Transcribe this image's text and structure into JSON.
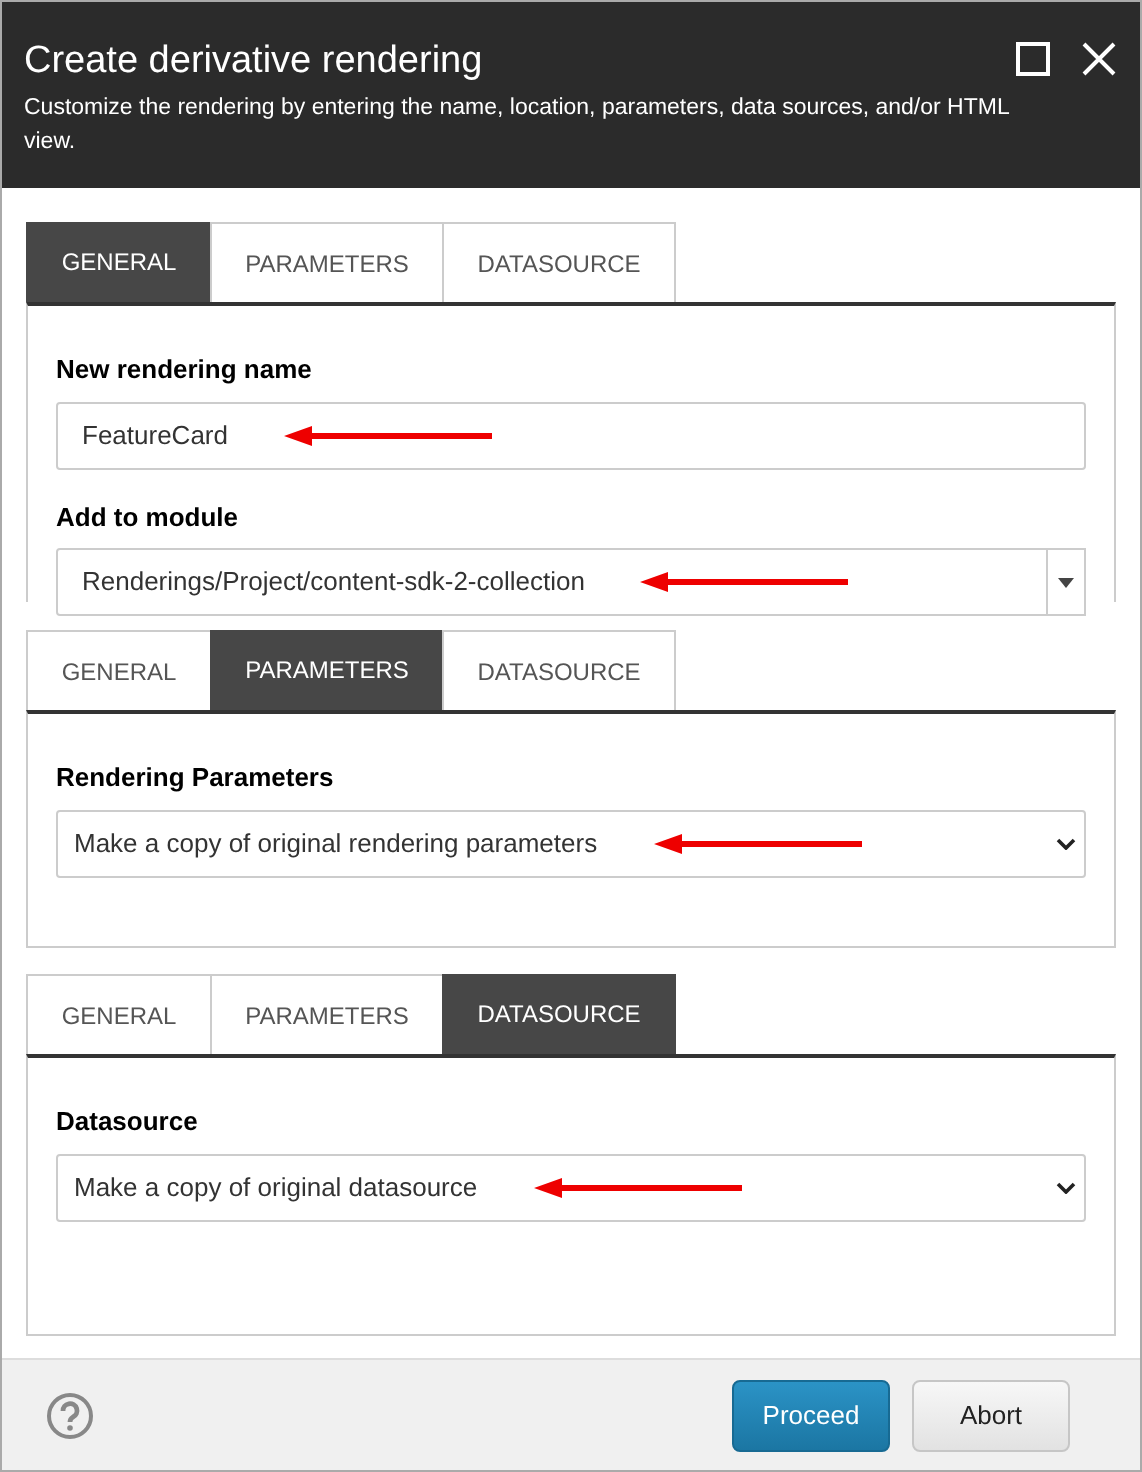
{
  "window": {
    "title": "Create derivative rendering",
    "subtitle": "Customize the rendering by entering the name, location, parameters, data sources, and/or HTML view."
  },
  "panels": [
    {
      "cut_off": true,
      "tabs": [
        {
          "label": "GENERAL",
          "selected": true
        },
        {
          "label": "PARAMETERS",
          "selected": false
        },
        {
          "label": "DATASOURCE",
          "selected": false
        }
      ],
      "fields": [
        {
          "kind": "text",
          "label": "New rendering name",
          "value": "FeatureCard",
          "annotated": true
        },
        {
          "kind": "combo",
          "label": "Add to module",
          "value": "Renderings/Project/content-sdk-2-collection",
          "annotated": true
        }
      ]
    },
    {
      "cut_off": false,
      "tabs": [
        {
          "label": "GENERAL",
          "selected": false
        },
        {
          "label": "PARAMETERS",
          "selected": true
        },
        {
          "label": "DATASOURCE",
          "selected": false
        }
      ],
      "fields": [
        {
          "kind": "select",
          "label": "Rendering Parameters",
          "value": "Make a copy of original rendering parameters",
          "annotated": true
        }
      ]
    },
    {
      "cut_off": false,
      "tabs": [
        {
          "label": "GENERAL",
          "selected": false
        },
        {
          "label": "PARAMETERS",
          "selected": false
        },
        {
          "label": "DATASOURCE",
          "selected": true
        }
      ],
      "fields": [
        {
          "kind": "select",
          "label": "Datasource",
          "value": "Make a copy of original datasource",
          "annotated": true
        }
      ]
    }
  ],
  "buttons": [
    {
      "label": "Proceed",
      "kind": "primary"
    },
    {
      "label": "Abort",
      "kind": "secondary"
    }
  ]
}
